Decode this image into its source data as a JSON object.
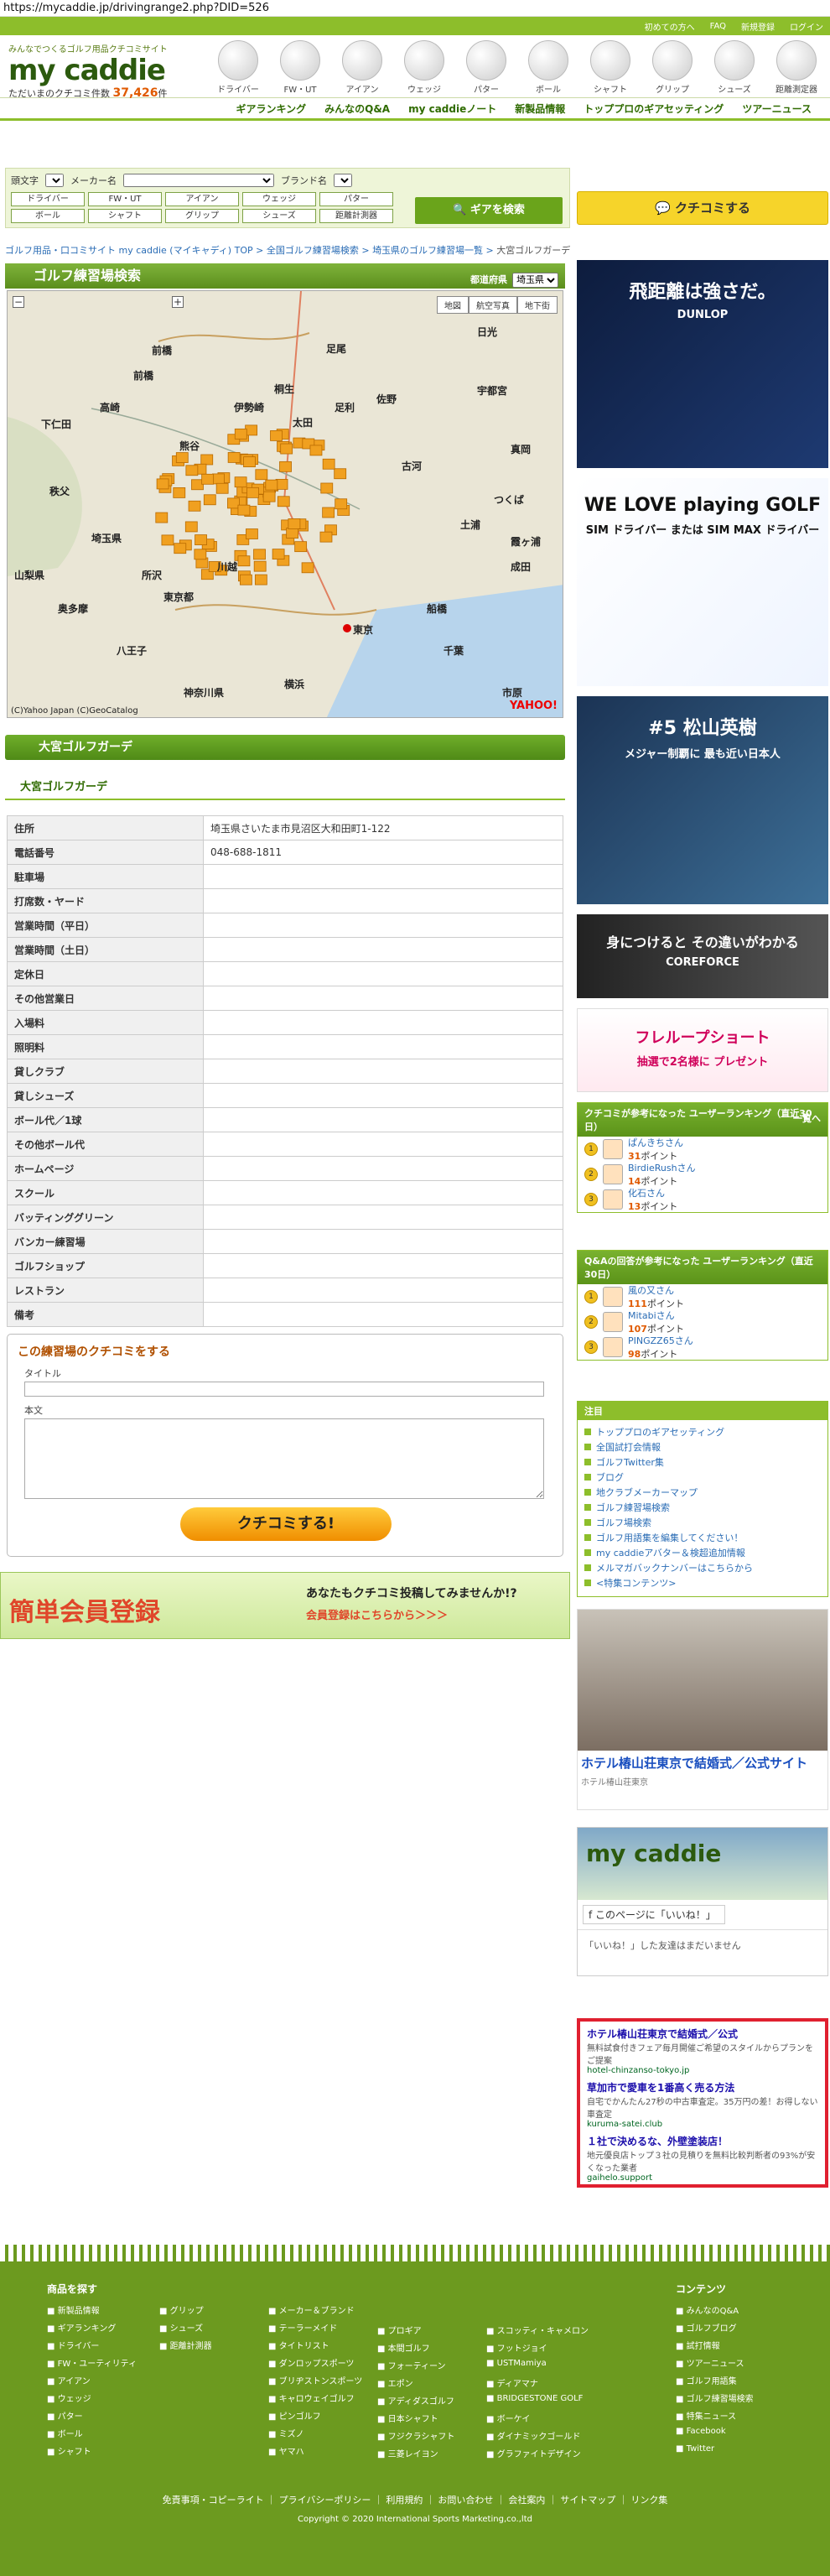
{
  "url": "https://mycaddie.jp/drivingrange2.php?DID=526",
  "topbar": {
    "links": [
      "初めての方へ",
      "FAQ",
      "新規登録",
      "ログイン"
    ]
  },
  "logo": {
    "tagline": "みんなでつくるゴルフ用品クチコミサイト",
    "word": "my caddie",
    "count_label": "ただいまのクチコミ件数",
    "count": "37,426",
    "count_unit": "件"
  },
  "categories": [
    "ドライバー",
    "FW・UT",
    "アイアン",
    "ウェッジ",
    "パター",
    "ボール",
    "シャフト",
    "グリップ",
    "シューズ",
    "距離測定器"
  ],
  "subnav": [
    "ギアランキング",
    "みんなのQ&A",
    "my caddieノート",
    "新製品情報",
    "トッププロのギアセッティング",
    "ツアーニュース"
  ],
  "search": {
    "label_initial": "頭文字",
    "label_maker": "メーカー名",
    "label_brand": "ブランド名",
    "filters": [
      "ドライバー",
      "FW・UT",
      "アイアン",
      "ウェッジ",
      "パター",
      "ボール",
      "シャフト",
      "グリップ",
      "シューズ",
      "距離計測器"
    ],
    "button": "ギアを検索"
  },
  "kuchikomi_button": "クチコミする",
  "breadcrumb": [
    "ゴルフ用品・口コミサイト my caddie (マイキャディ) TOP",
    "全国ゴルフ練習場検索",
    "埼玉県のゴルフ練習場一覧",
    "大宮ゴルフガーデ"
  ],
  "panel": {
    "title": "ゴルフ練習場検索",
    "pref_label": "都道府県",
    "pref_value": "埼玉県"
  },
  "map": {
    "tabs": [
      "地図",
      "航空写真",
      "地下街"
    ],
    "labels": [
      "前橋",
      "日光",
      "足尾",
      "桐生",
      "伊勢崎",
      "太田",
      "足利",
      "佐野",
      "宇都宮",
      "真岡",
      "下仁田",
      "高崎",
      "前橋",
      "古河",
      "つくば",
      "埼玉県",
      "山梨県",
      "奥多摩",
      "東京都",
      "東京",
      "千葉",
      "神奈川県",
      "八王子",
      "横浜",
      "秩父",
      "熊谷",
      "川越",
      "所沢",
      "船橋",
      "市原",
      "成田",
      "土浦",
      "霞ヶ浦"
    ],
    "copyright": "(C)Yahoo Japan (C)GeoCatalog",
    "brand": "YAHOO!"
  },
  "section": {
    "title": "大宮ゴルフガーデ",
    "subtitle": "大宮ゴルフガーデ"
  },
  "info": [
    {
      "k": "住所",
      "v": "埼玉県さいたま市見沼区大和田町1-122"
    },
    {
      "k": "電話番号",
      "v": "048-688-1811"
    },
    {
      "k": "駐車場",
      "v": ""
    },
    {
      "k": "打席数・ヤード",
      "v": ""
    },
    {
      "k": "営業時間（平日）",
      "v": ""
    },
    {
      "k": "営業時間（土日）",
      "v": ""
    },
    {
      "k": "定休日",
      "v": ""
    },
    {
      "k": "その他営業日",
      "v": ""
    },
    {
      "k": "入場料",
      "v": ""
    },
    {
      "k": "照明料",
      "v": ""
    },
    {
      "k": "貸しクラブ",
      "v": ""
    },
    {
      "k": "貸しシューズ",
      "v": ""
    },
    {
      "k": "ボール代／1球",
      "v": ""
    },
    {
      "k": "その他ボール代",
      "v": ""
    },
    {
      "k": "ホームページ",
      "v": ""
    },
    {
      "k": "スクール",
      "v": ""
    },
    {
      "k": "バッティンググリーン",
      "v": ""
    },
    {
      "k": "バンカー練習場",
      "v": ""
    },
    {
      "k": "ゴルフショップ",
      "v": ""
    },
    {
      "k": "レストラン",
      "v": ""
    },
    {
      "k": "備考",
      "v": ""
    }
  ],
  "form": {
    "heading": "この練習場のクチコミをする",
    "title_label": "タイトル",
    "body_label": "本文",
    "button": "クチコミする!"
  },
  "register": {
    "big": "簡単会員登録",
    "line1": "あなたもクチコミ投稿してみませんか!?",
    "line2": "会員登録はこちらから＞＞＞"
  },
  "ads": {
    "ad1": {
      "main": "飛距離は強さだ。",
      "sub": "DUNLOP"
    },
    "ad2": {
      "main": "WE LOVE playing GOLF",
      "sub": "SIM ドライバー または SIM MAX ドライバー"
    },
    "ad3": {
      "main": "#5 松山英樹",
      "sub": "メジャー制覇に 最も近い日本人"
    },
    "ad4": {
      "main": "身につけると その違いがわかる",
      "sub": "COREFORCE"
    },
    "ad5": {
      "main": "フレループショート",
      "sub": "抽選で2名様に プレゼント"
    }
  },
  "ranking1": {
    "title": "クチコミが参考になった ユーザーランキング（直近30日）",
    "more": "一覧へ",
    "rows": [
      {
        "name": "ぱんきちさん",
        "points": "31",
        "unit": "ポイント"
      },
      {
        "name": "BirdieRushさん",
        "points": "14",
        "unit": "ポイント"
      },
      {
        "name": "化石さん",
        "points": "13",
        "unit": "ポイント"
      }
    ]
  },
  "ranking2": {
    "title": "Q&Aの回答が参考になった ユーザーランキング（直近30日）",
    "rows": [
      {
        "name": "風の又さん",
        "points": "111",
        "unit": "ポイント"
      },
      {
        "name": "Mitabiさん",
        "points": "107",
        "unit": "ポイント"
      },
      {
        "name": "PINGZZ65さん",
        "points": "98",
        "unit": "ポイント"
      }
    ]
  },
  "notice": {
    "title": "注目",
    "items": [
      "トッププロのギアセッティング",
      "全国試打会情報",
      "ゴルフTwitter集",
      "ブログ",
      "地クラブメーカーマップ",
      "ゴルフ練習場検索",
      "ゴルフ場検索",
      "ゴルフ用語集を編集してください！",
      "my caddieアバター＆検超追加情報",
      "メルマガバックナンバーはこちらから",
      "<特集コンテンツ>"
    ]
  },
  "hotel": {
    "title": "ホテル椿山荘東京で結婚式／公式サイト",
    "url": "ホテル椿山荘東京"
  },
  "fb": {
    "cover": "my caddie",
    "like": "このページに「いいね！」",
    "note": "「いいね！」した友達はまだいません"
  },
  "gads": [
    {
      "title": "ホテル椿山荘東京で結婚式／公式",
      "desc": "無料試食付きフェア毎月開催ご希望のスタイルからプランをご提案",
      "url": "hotel-chinzanso-tokyo.jp"
    },
    {
      "title": "草加市で愛車を1番高く売る方法",
      "desc": "自宅でかんたん27秒の中古車査定。35万円の差！お得しない車査定",
      "url": "kuruma-satei.club"
    },
    {
      "title": "１社で決めるな、外壁塗装店！",
      "desc": "地元優良店トップ３社の見積りを無料比較判断者の93%が安くなった業者",
      "url": "gaihelo.support"
    }
  ],
  "footer": {
    "goods_title": "商品を探す",
    "content_title": "コンテンツ",
    "col1": [
      "新製品情報",
      "ギアランキング",
      "ドライバー",
      "FW・ユーティリティ",
      "アイアン",
      "ウェッジ",
      "パター",
      "ボール",
      "シャフト"
    ],
    "col2": [
      "グリップ",
      "シューズ",
      "距離計測器"
    ],
    "col3": [
      "メーカー＆ブランド",
      "テーラーメイド",
      "タイトリスト",
      "ダンロップスポーツ",
      "ブリヂストンスポーツ",
      "キャロウェイゴルフ",
      "ピンゴルフ",
      "ミズノ",
      "ヤマハ"
    ],
    "col4": [
      "プロギア",
      "本間ゴルフ",
      "フォーティーン",
      "エポン",
      "アディダスゴルフ",
      "日本シャフト",
      "フジクラシャフト",
      "三菱レイヨン"
    ],
    "col5": [
      "スコッティ・キャメロン",
      "フットジョイ",
      "USTMamiya",
      "ディアマナ",
      "BRIDGESTONE GOLF",
      "ボーケイ",
      "ダイナミックゴールド",
      "グラファイトデザイン"
    ],
    "col6": [
      "みんなのQ&A",
      "ゴルフブログ",
      "試打情報",
      "ツアーニュース",
      "ゴルフ用語集",
      "ゴルフ練習場検索",
      "特集ニュース",
      "Facebook",
      "Twitter"
    ],
    "links": "免責事項・コピーライト ｜ プライバシーポリシー ｜ 利用規約 ｜ お問い合わせ ｜ 会社案内 ｜ サイトマップ ｜ リンク集",
    "copyright": "Copyright © 2020 International Sports Marketing,co.,ltd"
  }
}
